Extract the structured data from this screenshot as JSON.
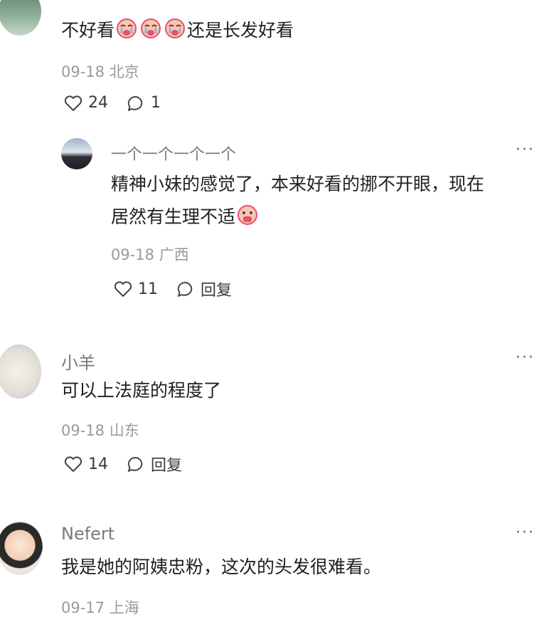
{
  "comments": [
    {
      "name": "",
      "text_before": "不好看",
      "text_after": "还是长发好看",
      "emoji": "crying-face-emoji",
      "date": "09-18",
      "location": "北京",
      "likes": "24",
      "replies": "1"
    },
    {
      "name": "一个一个一个一个",
      "text_line1": "精神小妹的感觉了，本来好看的挪不开眼，现在",
      "text_line2": "居然有生理不适",
      "emoji": "anguished-face-emoji",
      "date": "09-18",
      "location": "广西",
      "likes": "11",
      "reply_label": "回复"
    },
    {
      "name": "小羊",
      "text": "可以上法庭的程度了",
      "date": "09-18",
      "location": "山东",
      "likes": "14",
      "reply_label": "回复"
    },
    {
      "name": "Nefert",
      "text": "我是她的阿姨忠粉，这次的头发很难看。",
      "date": "09-17",
      "location": "上海"
    }
  ],
  "more_label": "···",
  "colors": {
    "emoji_red": "#e8506a",
    "emoji_skin": "#f6c7b4"
  }
}
